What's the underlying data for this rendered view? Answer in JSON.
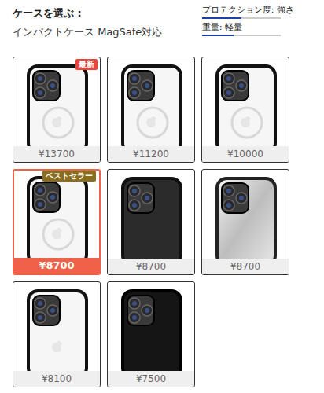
{
  "header": {
    "title": "ケースを選ぶ :",
    "subtitle": "インパクトケース MagSafe対応"
  },
  "specs": [
    {
      "label": "プロテクション度: 強さ",
      "level": 0.5
    },
    {
      "label": "重量: 軽量",
      "level": 0.4
    }
  ],
  "cards": [
    {
      "price": "¥13700",
      "badge": "最新",
      "selected": false,
      "kind": "clear-magsafe"
    },
    {
      "price": "¥11200",
      "badge": "",
      "selected": false,
      "kind": "clear-magsafe"
    },
    {
      "price": "¥10000",
      "badge": "",
      "selected": false,
      "kind": "clear-magsafe"
    },
    {
      "price": "¥8700",
      "badge": "ベストセラー",
      "selected": true,
      "kind": "clear-magsafe"
    },
    {
      "price": "¥8700",
      "badge": "",
      "selected": false,
      "kind": "leather"
    },
    {
      "price": "¥8700",
      "badge": "",
      "selected": false,
      "kind": "mirror"
    },
    {
      "price": "¥8100",
      "badge": "",
      "selected": false,
      "kind": "clear"
    },
    {
      "price": "¥7500",
      "badge": "",
      "selected": false,
      "kind": "black"
    }
  ]
}
